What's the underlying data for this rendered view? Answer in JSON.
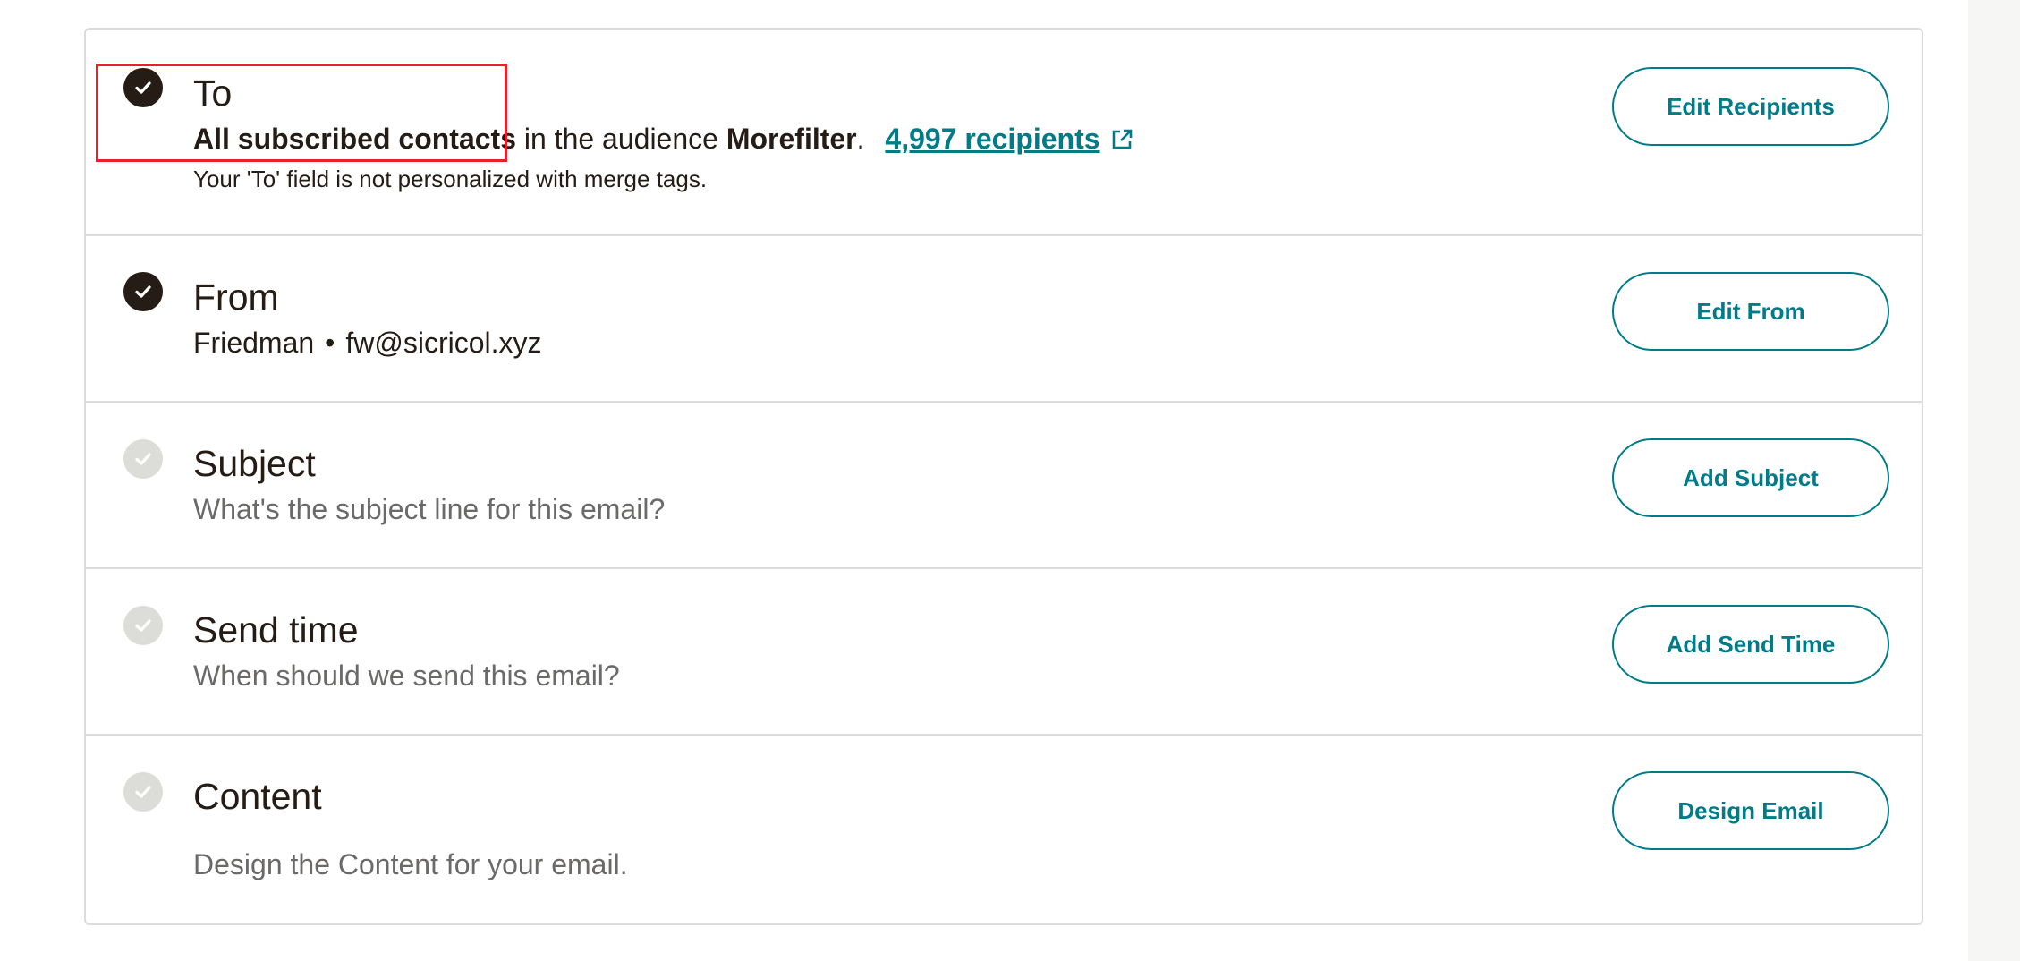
{
  "colors": {
    "accent": "#007c89",
    "text": "#241c15",
    "muted": "#6b6a68",
    "border": "#dcdcdb",
    "highlight": "#e8202a"
  },
  "rows": {
    "to": {
      "title": "To",
      "status": "complete",
      "audience_segment": "All subscribed contacts",
      "audience_middle": " in the audience ",
      "audience_name": "Morefilter",
      "audience_end": ".",
      "recipients_link": "4,997 recipients",
      "note": "Your 'To' field is not personalized with merge tags.",
      "button": "Edit Recipients"
    },
    "from": {
      "title": "From",
      "status": "complete",
      "name": "Friedman",
      "separator": "•",
      "email": "fw@sicricol.xyz",
      "button": "Edit From"
    },
    "subject": {
      "title": "Subject",
      "status": "incomplete",
      "description": "What's the subject line for this email?",
      "button": "Add Subject"
    },
    "send_time": {
      "title": "Send time",
      "status": "incomplete",
      "description": "When should we send this email?",
      "button": "Add Send Time"
    },
    "content": {
      "title": "Content",
      "status": "incomplete",
      "description": "Design the Content for your email.",
      "button": "Design Email"
    }
  },
  "icons": {
    "check": "checkmark-icon",
    "external": "external-link-icon"
  }
}
